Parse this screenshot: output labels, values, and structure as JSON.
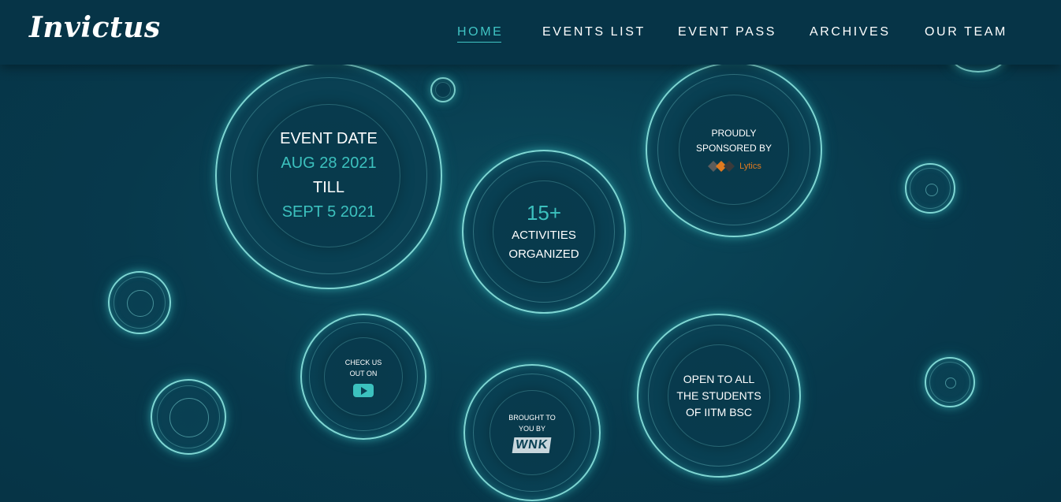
{
  "brand": {
    "name": "Invictus"
  },
  "nav": {
    "items": [
      {
        "label": "HOME",
        "active": true
      },
      {
        "label": "EVENTS LIST",
        "active": false
      },
      {
        "label": "EVENT PASS",
        "active": false
      },
      {
        "label": "ARCHIVES",
        "active": false
      },
      {
        "label": "OUR TEAM",
        "active": false
      }
    ]
  },
  "bubbles": {
    "event_date": {
      "heading": "EVENT DATE",
      "start": "AUG 28 2021",
      "till": "TILL",
      "end": "SEPT 5 2021"
    },
    "activities": {
      "count": "15+",
      "line1": "ACTIVITIES",
      "line2": "ORGANIZED"
    },
    "sponsor": {
      "line1": "PROUDLY",
      "line2": "SPONSORED BY",
      "logo_text": "Lytics",
      "logo_icon": "sponsor-logo-icon"
    },
    "youtube": {
      "line1": "CHECK US",
      "line2": "OUT ON",
      "icon": "youtube-icon"
    },
    "brought": {
      "line1": "BROUGHT TO",
      "line2": "YOU BY",
      "logo_text": "WNK"
    },
    "open": {
      "line1": "OPEN TO ALL",
      "line2": "THE STUDENTS",
      "line3": "OF IITM BSC"
    }
  },
  "colors": {
    "background": "#07394c",
    "navbar": "#063447",
    "accent": "#3cc1be",
    "ring": "#7fd6d3"
  }
}
